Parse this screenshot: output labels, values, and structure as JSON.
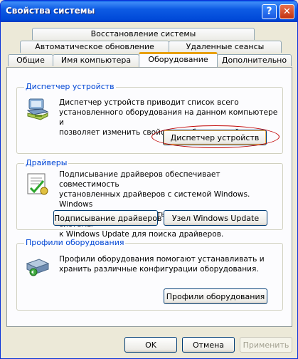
{
  "window": {
    "title": "Свойства системы"
  },
  "titlebar_buttons": {
    "help": "?",
    "close": "✕"
  },
  "tabs": {
    "row1": [
      "Восстановление системы"
    ],
    "row2": [
      "Автоматическое обновление",
      "Удаленные сеансы"
    ],
    "row3": [
      "Общие",
      "Имя компьютера",
      "Оборудование",
      "Дополнительно"
    ],
    "active": "Оборудование"
  },
  "device_manager": {
    "title": "Диспетчер устройств",
    "description": [
      "Диспетчер устройств приводит список всего",
      "установленного оборудования на данном компьютере и",
      "позволяет изменить свойства любого устройства."
    ],
    "button": "Диспетчер устройств"
  },
  "drivers": {
    "title": "Драйверы",
    "description": [
      "Подписывание драйверов обеспечивает совместимость",
      "установленных драйверов с системой Windows.  Windows",
      "Update позволяет выбрать способ подключения системы",
      "к Windows Update для поиска драйверов."
    ],
    "button_signing": "Подписывание драйверов",
    "button_update": "Узел Windows Update"
  },
  "profiles": {
    "title": "Профили оборудования",
    "description": [
      "Профили оборудования помогают устанавливать и",
      "хранить различные конфигурации оборудования."
    ],
    "button": "Профили оборудования"
  },
  "footer": {
    "ok": "OK",
    "cancel": "Отмена",
    "apply": "Применить"
  },
  "colors": {
    "titlebar": "#0054e3",
    "accent_tab": "#e8a000",
    "group_title": "#0046d5",
    "highlight": "#c00000"
  },
  "icons": [
    "device-manager-icon",
    "driver-signing-icon",
    "hardware-profile-icon"
  ]
}
